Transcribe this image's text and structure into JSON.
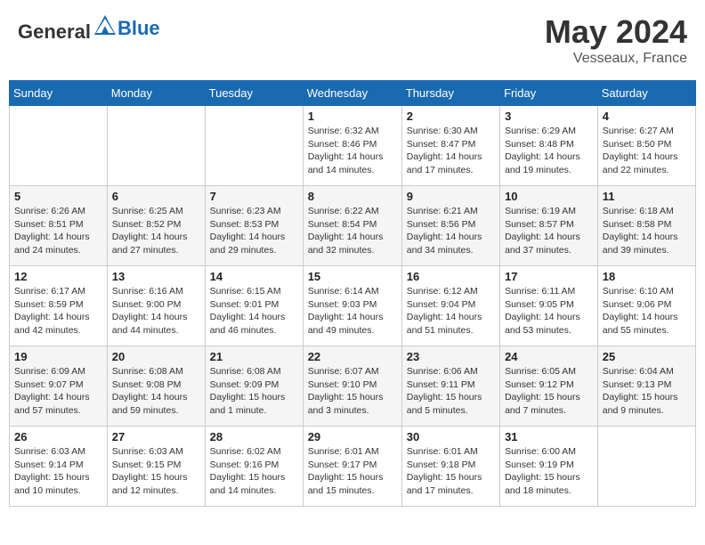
{
  "header": {
    "logo_general": "General",
    "logo_blue": "Blue",
    "title": "May 2024",
    "location": "Vesseaux, France"
  },
  "weekdays": [
    "Sunday",
    "Monday",
    "Tuesday",
    "Wednesday",
    "Thursday",
    "Friday",
    "Saturday"
  ],
  "weeks": [
    [
      {
        "day": "",
        "info": ""
      },
      {
        "day": "",
        "info": ""
      },
      {
        "day": "",
        "info": ""
      },
      {
        "day": "1",
        "info": "Sunrise: 6:32 AM\nSunset: 8:46 PM\nDaylight: 14 hours\nand 14 minutes."
      },
      {
        "day": "2",
        "info": "Sunrise: 6:30 AM\nSunset: 8:47 PM\nDaylight: 14 hours\nand 17 minutes."
      },
      {
        "day": "3",
        "info": "Sunrise: 6:29 AM\nSunset: 8:48 PM\nDaylight: 14 hours\nand 19 minutes."
      },
      {
        "day": "4",
        "info": "Sunrise: 6:27 AM\nSunset: 8:50 PM\nDaylight: 14 hours\nand 22 minutes."
      }
    ],
    [
      {
        "day": "5",
        "info": "Sunrise: 6:26 AM\nSunset: 8:51 PM\nDaylight: 14 hours\nand 24 minutes."
      },
      {
        "day": "6",
        "info": "Sunrise: 6:25 AM\nSunset: 8:52 PM\nDaylight: 14 hours\nand 27 minutes."
      },
      {
        "day": "7",
        "info": "Sunrise: 6:23 AM\nSunset: 8:53 PM\nDaylight: 14 hours\nand 29 minutes."
      },
      {
        "day": "8",
        "info": "Sunrise: 6:22 AM\nSunset: 8:54 PM\nDaylight: 14 hours\nand 32 minutes."
      },
      {
        "day": "9",
        "info": "Sunrise: 6:21 AM\nSunset: 8:56 PM\nDaylight: 14 hours\nand 34 minutes."
      },
      {
        "day": "10",
        "info": "Sunrise: 6:19 AM\nSunset: 8:57 PM\nDaylight: 14 hours\nand 37 minutes."
      },
      {
        "day": "11",
        "info": "Sunrise: 6:18 AM\nSunset: 8:58 PM\nDaylight: 14 hours\nand 39 minutes."
      }
    ],
    [
      {
        "day": "12",
        "info": "Sunrise: 6:17 AM\nSunset: 8:59 PM\nDaylight: 14 hours\nand 42 minutes."
      },
      {
        "day": "13",
        "info": "Sunrise: 6:16 AM\nSunset: 9:00 PM\nDaylight: 14 hours\nand 44 minutes."
      },
      {
        "day": "14",
        "info": "Sunrise: 6:15 AM\nSunset: 9:01 PM\nDaylight: 14 hours\nand 46 minutes."
      },
      {
        "day": "15",
        "info": "Sunrise: 6:14 AM\nSunset: 9:03 PM\nDaylight: 14 hours\nand 49 minutes."
      },
      {
        "day": "16",
        "info": "Sunrise: 6:12 AM\nSunset: 9:04 PM\nDaylight: 14 hours\nand 51 minutes."
      },
      {
        "day": "17",
        "info": "Sunrise: 6:11 AM\nSunset: 9:05 PM\nDaylight: 14 hours\nand 53 minutes."
      },
      {
        "day": "18",
        "info": "Sunrise: 6:10 AM\nSunset: 9:06 PM\nDaylight: 14 hours\nand 55 minutes."
      }
    ],
    [
      {
        "day": "19",
        "info": "Sunrise: 6:09 AM\nSunset: 9:07 PM\nDaylight: 14 hours\nand 57 minutes."
      },
      {
        "day": "20",
        "info": "Sunrise: 6:08 AM\nSunset: 9:08 PM\nDaylight: 14 hours\nand 59 minutes."
      },
      {
        "day": "21",
        "info": "Sunrise: 6:08 AM\nSunset: 9:09 PM\nDaylight: 15 hours\nand 1 minute."
      },
      {
        "day": "22",
        "info": "Sunrise: 6:07 AM\nSunset: 9:10 PM\nDaylight: 15 hours\nand 3 minutes."
      },
      {
        "day": "23",
        "info": "Sunrise: 6:06 AM\nSunset: 9:11 PM\nDaylight: 15 hours\nand 5 minutes."
      },
      {
        "day": "24",
        "info": "Sunrise: 6:05 AM\nSunset: 9:12 PM\nDaylight: 15 hours\nand 7 minutes."
      },
      {
        "day": "25",
        "info": "Sunrise: 6:04 AM\nSunset: 9:13 PM\nDaylight: 15 hours\nand 9 minutes."
      }
    ],
    [
      {
        "day": "26",
        "info": "Sunrise: 6:03 AM\nSunset: 9:14 PM\nDaylight: 15 hours\nand 10 minutes."
      },
      {
        "day": "27",
        "info": "Sunrise: 6:03 AM\nSunset: 9:15 PM\nDaylight: 15 hours\nand 12 minutes."
      },
      {
        "day": "28",
        "info": "Sunrise: 6:02 AM\nSunset: 9:16 PM\nDaylight: 15 hours\nand 14 minutes."
      },
      {
        "day": "29",
        "info": "Sunrise: 6:01 AM\nSunset: 9:17 PM\nDaylight: 15 hours\nand 15 minutes."
      },
      {
        "day": "30",
        "info": "Sunrise: 6:01 AM\nSunset: 9:18 PM\nDaylight: 15 hours\nand 17 minutes."
      },
      {
        "day": "31",
        "info": "Sunrise: 6:00 AM\nSunset: 9:19 PM\nDaylight: 15 hours\nand 18 minutes."
      },
      {
        "day": "",
        "info": ""
      }
    ]
  ]
}
